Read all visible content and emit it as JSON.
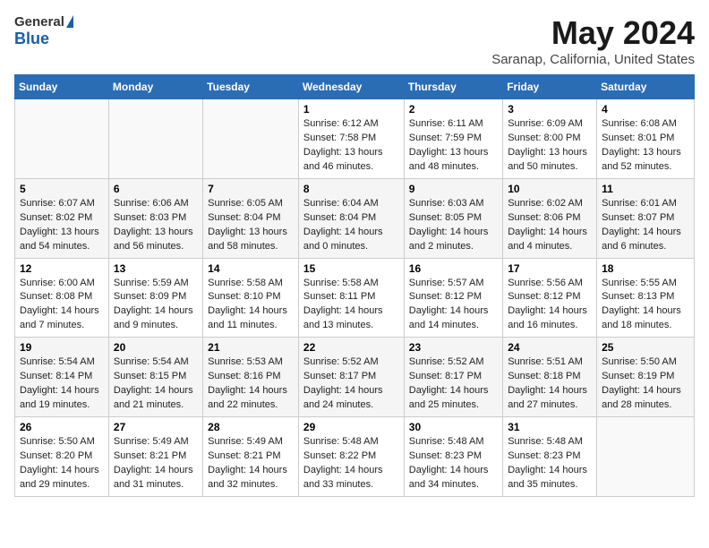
{
  "header": {
    "logo_general": "General",
    "logo_blue": "Blue",
    "title": "May 2024",
    "subtitle": "Saranap, California, United States"
  },
  "weekdays": [
    "Sunday",
    "Monday",
    "Tuesday",
    "Wednesday",
    "Thursday",
    "Friday",
    "Saturday"
  ],
  "weeks": [
    [
      {
        "day": "",
        "sunrise": "",
        "sunset": "",
        "daylight": ""
      },
      {
        "day": "",
        "sunrise": "",
        "sunset": "",
        "daylight": ""
      },
      {
        "day": "",
        "sunrise": "",
        "sunset": "",
        "daylight": ""
      },
      {
        "day": "1",
        "sunrise": "Sunrise: 6:12 AM",
        "sunset": "Sunset: 7:58 PM",
        "daylight": "Daylight: 13 hours and 46 minutes."
      },
      {
        "day": "2",
        "sunrise": "Sunrise: 6:11 AM",
        "sunset": "Sunset: 7:59 PM",
        "daylight": "Daylight: 13 hours and 48 minutes."
      },
      {
        "day": "3",
        "sunrise": "Sunrise: 6:09 AM",
        "sunset": "Sunset: 8:00 PM",
        "daylight": "Daylight: 13 hours and 50 minutes."
      },
      {
        "day": "4",
        "sunrise": "Sunrise: 6:08 AM",
        "sunset": "Sunset: 8:01 PM",
        "daylight": "Daylight: 13 hours and 52 minutes."
      }
    ],
    [
      {
        "day": "5",
        "sunrise": "Sunrise: 6:07 AM",
        "sunset": "Sunset: 8:02 PM",
        "daylight": "Daylight: 13 hours and 54 minutes."
      },
      {
        "day": "6",
        "sunrise": "Sunrise: 6:06 AM",
        "sunset": "Sunset: 8:03 PM",
        "daylight": "Daylight: 13 hours and 56 minutes."
      },
      {
        "day": "7",
        "sunrise": "Sunrise: 6:05 AM",
        "sunset": "Sunset: 8:04 PM",
        "daylight": "Daylight: 13 hours and 58 minutes."
      },
      {
        "day": "8",
        "sunrise": "Sunrise: 6:04 AM",
        "sunset": "Sunset: 8:04 PM",
        "daylight": "Daylight: 14 hours and 0 minutes."
      },
      {
        "day": "9",
        "sunrise": "Sunrise: 6:03 AM",
        "sunset": "Sunset: 8:05 PM",
        "daylight": "Daylight: 14 hours and 2 minutes."
      },
      {
        "day": "10",
        "sunrise": "Sunrise: 6:02 AM",
        "sunset": "Sunset: 8:06 PM",
        "daylight": "Daylight: 14 hours and 4 minutes."
      },
      {
        "day": "11",
        "sunrise": "Sunrise: 6:01 AM",
        "sunset": "Sunset: 8:07 PM",
        "daylight": "Daylight: 14 hours and 6 minutes."
      }
    ],
    [
      {
        "day": "12",
        "sunrise": "Sunrise: 6:00 AM",
        "sunset": "Sunset: 8:08 PM",
        "daylight": "Daylight: 14 hours and 7 minutes."
      },
      {
        "day": "13",
        "sunrise": "Sunrise: 5:59 AM",
        "sunset": "Sunset: 8:09 PM",
        "daylight": "Daylight: 14 hours and 9 minutes."
      },
      {
        "day": "14",
        "sunrise": "Sunrise: 5:58 AM",
        "sunset": "Sunset: 8:10 PM",
        "daylight": "Daylight: 14 hours and 11 minutes."
      },
      {
        "day": "15",
        "sunrise": "Sunrise: 5:58 AM",
        "sunset": "Sunset: 8:11 PM",
        "daylight": "Daylight: 14 hours and 13 minutes."
      },
      {
        "day": "16",
        "sunrise": "Sunrise: 5:57 AM",
        "sunset": "Sunset: 8:12 PM",
        "daylight": "Daylight: 14 hours and 14 minutes."
      },
      {
        "day": "17",
        "sunrise": "Sunrise: 5:56 AM",
        "sunset": "Sunset: 8:12 PM",
        "daylight": "Daylight: 14 hours and 16 minutes."
      },
      {
        "day": "18",
        "sunrise": "Sunrise: 5:55 AM",
        "sunset": "Sunset: 8:13 PM",
        "daylight": "Daylight: 14 hours and 18 minutes."
      }
    ],
    [
      {
        "day": "19",
        "sunrise": "Sunrise: 5:54 AM",
        "sunset": "Sunset: 8:14 PM",
        "daylight": "Daylight: 14 hours and 19 minutes."
      },
      {
        "day": "20",
        "sunrise": "Sunrise: 5:54 AM",
        "sunset": "Sunset: 8:15 PM",
        "daylight": "Daylight: 14 hours and 21 minutes."
      },
      {
        "day": "21",
        "sunrise": "Sunrise: 5:53 AM",
        "sunset": "Sunset: 8:16 PM",
        "daylight": "Daylight: 14 hours and 22 minutes."
      },
      {
        "day": "22",
        "sunrise": "Sunrise: 5:52 AM",
        "sunset": "Sunset: 8:17 PM",
        "daylight": "Daylight: 14 hours and 24 minutes."
      },
      {
        "day": "23",
        "sunrise": "Sunrise: 5:52 AM",
        "sunset": "Sunset: 8:17 PM",
        "daylight": "Daylight: 14 hours and 25 minutes."
      },
      {
        "day": "24",
        "sunrise": "Sunrise: 5:51 AM",
        "sunset": "Sunset: 8:18 PM",
        "daylight": "Daylight: 14 hours and 27 minutes."
      },
      {
        "day": "25",
        "sunrise": "Sunrise: 5:50 AM",
        "sunset": "Sunset: 8:19 PM",
        "daylight": "Daylight: 14 hours and 28 minutes."
      }
    ],
    [
      {
        "day": "26",
        "sunrise": "Sunrise: 5:50 AM",
        "sunset": "Sunset: 8:20 PM",
        "daylight": "Daylight: 14 hours and 29 minutes."
      },
      {
        "day": "27",
        "sunrise": "Sunrise: 5:49 AM",
        "sunset": "Sunset: 8:21 PM",
        "daylight": "Daylight: 14 hours and 31 minutes."
      },
      {
        "day": "28",
        "sunrise": "Sunrise: 5:49 AM",
        "sunset": "Sunset: 8:21 PM",
        "daylight": "Daylight: 14 hours and 32 minutes."
      },
      {
        "day": "29",
        "sunrise": "Sunrise: 5:48 AM",
        "sunset": "Sunset: 8:22 PM",
        "daylight": "Daylight: 14 hours and 33 minutes."
      },
      {
        "day": "30",
        "sunrise": "Sunrise: 5:48 AM",
        "sunset": "Sunset: 8:23 PM",
        "daylight": "Daylight: 14 hours and 34 minutes."
      },
      {
        "day": "31",
        "sunrise": "Sunrise: 5:48 AM",
        "sunset": "Sunset: 8:23 PM",
        "daylight": "Daylight: 14 hours and 35 minutes."
      },
      {
        "day": "",
        "sunrise": "",
        "sunset": "",
        "daylight": ""
      }
    ]
  ]
}
